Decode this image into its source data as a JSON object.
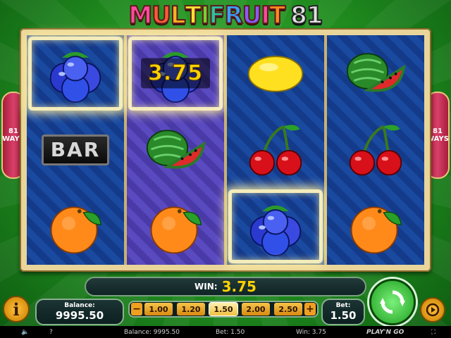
{
  "title": {
    "word": "MULTIFRUIT",
    "number": "81"
  },
  "ways": {
    "count": "81",
    "label": "WAYS"
  },
  "reels": [
    {
      "style": "blue",
      "cells": [
        {
          "symbol": "blueberry-icon",
          "win": true
        },
        {
          "symbol": "bar",
          "label": "BAR",
          "win": false
        },
        {
          "symbol": "orange-icon",
          "win": false
        }
      ]
    },
    {
      "style": "purple",
      "cells": [
        {
          "symbol": "blueberry-icon",
          "win": true
        },
        {
          "symbol": "watermelon-icon",
          "win": false
        },
        {
          "symbol": "orange-icon",
          "win": false
        }
      ]
    },
    {
      "style": "blue",
      "cells": [
        {
          "symbol": "lemon-icon",
          "win": false
        },
        {
          "symbol": "cherries-icon",
          "win": false
        },
        {
          "symbol": "blueberry-icon",
          "win": true
        }
      ]
    },
    {
      "style": "blue",
      "cells": [
        {
          "symbol": "watermelon-icon",
          "win": false
        },
        {
          "symbol": "cherries-icon",
          "win": false
        },
        {
          "symbol": "orange-icon",
          "win": false
        }
      ]
    }
  ],
  "win_overlay": "3.75",
  "hud": {
    "win_label": "WIN:",
    "win_value": "3.75",
    "balance_label": "Balance:",
    "balance_value": "9995.50",
    "bet_label": "Bet:",
    "bet_value": "1.50",
    "bet_options": [
      "1.00",
      "1.20",
      "1.50",
      "2.00",
      "2.50"
    ],
    "selected_bet": "1.50",
    "minus": "−",
    "plus": "+",
    "info": "i"
  },
  "status": {
    "help": "?",
    "balance": "Balance: 9995.50",
    "bet": "Bet: 1.50",
    "win": "Win: 3.75",
    "brand": "PLAY'N GO"
  },
  "colors": {
    "background": "#1f8a1e",
    "reel_blue": "#143a8a",
    "reel_purple": "#4a3aa8",
    "win_gold": "#ffd200"
  }
}
